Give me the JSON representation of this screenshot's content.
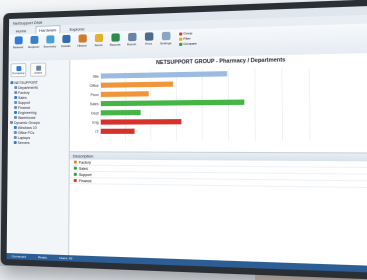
{
  "window": {
    "title": "NetSupport DNA"
  },
  "tabs": [
    {
      "label": "Home"
    },
    {
      "label": "Hardware"
    },
    {
      "label": "Explorer"
    }
  ],
  "ribbon": {
    "buttons": [
      {
        "label": "Refresh",
        "color": "#2f7bd8"
      },
      {
        "label": "Explorer",
        "color": "#3a7fc4"
      },
      {
        "label": "Summary",
        "color": "#4a9fd6"
      },
      {
        "label": "Details",
        "color": "#2f6cb3"
      },
      {
        "label": "History",
        "color": "#d27b2b"
      },
      {
        "label": "Alerts",
        "color": "#e0b330"
      },
      {
        "label": "Reports",
        "color": "#2d8c4c"
      },
      {
        "label": "Export",
        "color": "#6a84a6"
      },
      {
        "label": "Print",
        "color": "#4d6b8a"
      },
      {
        "label": "Settings",
        "color": "#8aa5c2"
      }
    ],
    "small_items": [
      {
        "label": "Group",
        "color": "#d43b33"
      },
      {
        "label": "Filter",
        "color": "#e7a52b"
      },
      {
        "label": "Compare",
        "color": "#2d9a4e"
      }
    ]
  },
  "sidebar": {
    "buttons": [
      {
        "label": "Company"
      },
      {
        "label": "Users"
      }
    ],
    "items": [
      {
        "label": "NETSUPPORT"
      },
      {
        "label": "Departments"
      },
      {
        "label": "Factory"
      },
      {
        "label": "Sales"
      },
      {
        "label": "Support"
      },
      {
        "label": "Finance"
      },
      {
        "label": "Engineering"
      },
      {
        "label": "Warehouse"
      },
      {
        "label": "Dynamic Groups"
      },
      {
        "label": "Windows 10"
      },
      {
        "label": "Office PCs"
      },
      {
        "label": "Laptops"
      },
      {
        "label": "Servers"
      }
    ]
  },
  "chart_data": {
    "type": "bar",
    "title": "NETSUPPORT GROUP - Pharmacy / Departments",
    "categories": [
      "Site",
      "Office",
      "Floor",
      "Sales",
      "Dept",
      "Eng",
      "IT"
    ],
    "values": [
      0.62,
      0.36,
      0.24,
      0.7,
      0.2,
      0.4,
      0.17
    ],
    "colors": [
      "#9bbbe0",
      "#f0953a",
      "#f0953a",
      "#45b545",
      "#45b545",
      "#d6312b",
      "#d6312b"
    ],
    "xlim": [
      0,
      1
    ]
  },
  "details": {
    "header": "Description",
    "rows": [
      {
        "label": "Factory",
        "color": "#e4892b"
      },
      {
        "label": "Sales",
        "color": "#2d9a4e"
      },
      {
        "label": "Support",
        "color": "#2d9a4e"
      },
      {
        "label": "Finance",
        "color": "#d43b33"
      }
    ]
  },
  "status": {
    "items": [
      {
        "label": "Connected"
      },
      {
        "label": "Ready"
      },
      {
        "label": "Users: 42"
      }
    ]
  }
}
